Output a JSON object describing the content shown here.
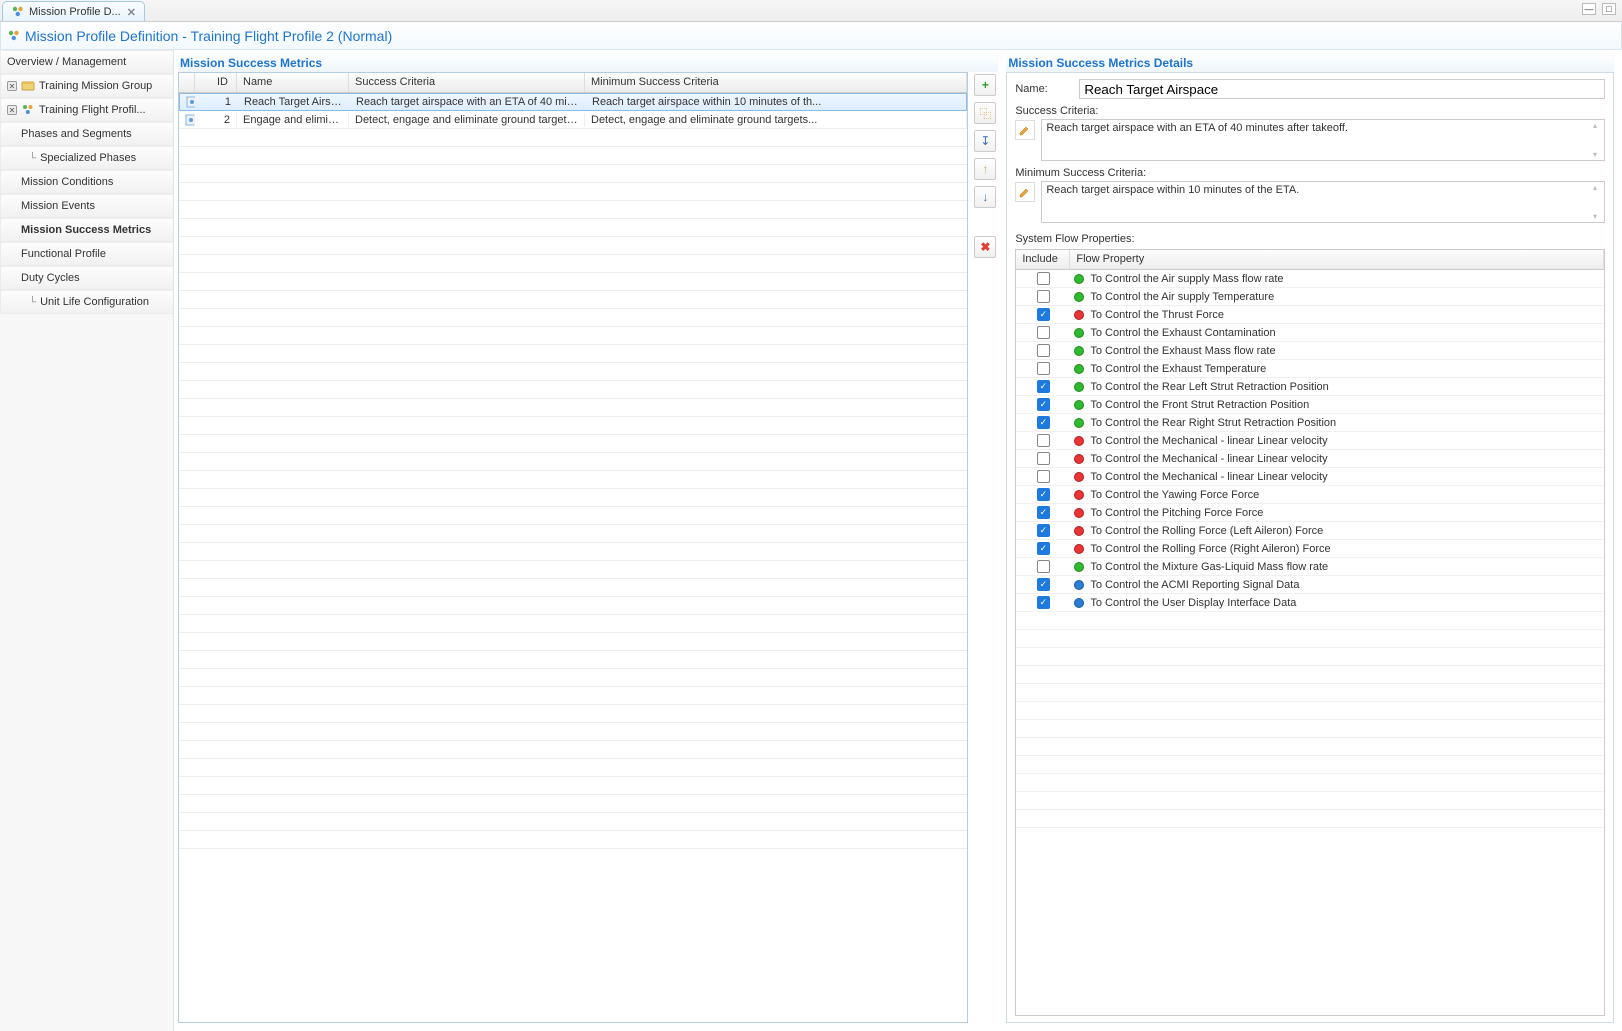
{
  "tab": {
    "label": "Mission Profile D..."
  },
  "title": "Mission Profile Definition - Training Flight Profile 2 (Normal)",
  "sidebar": [
    {
      "label": "Overview / Management",
      "indent": 0,
      "bold": false,
      "has_expand": false,
      "icon": "none"
    },
    {
      "label": "Training Mission Group",
      "indent": 0,
      "bold": false,
      "has_expand": true,
      "icon": "group"
    },
    {
      "label": "Training Flight Profil...",
      "indent": 0,
      "bold": false,
      "has_expand": true,
      "icon": "profile"
    },
    {
      "label": "Phases and Segments",
      "indent": 1,
      "bold": false,
      "has_expand": false,
      "icon": "none"
    },
    {
      "label": "Specialized Phases",
      "indent": 2,
      "bold": false,
      "has_expand": false,
      "icon": "none",
      "prefix": "└"
    },
    {
      "label": "Mission Conditions",
      "indent": 1,
      "bold": false,
      "has_expand": false,
      "icon": "none"
    },
    {
      "label": "Mission Events",
      "indent": 1,
      "bold": false,
      "has_expand": false,
      "icon": "none"
    },
    {
      "label": "Mission Success Metrics",
      "indent": 1,
      "bold": true,
      "has_expand": false,
      "icon": "none"
    },
    {
      "label": "Functional Profile",
      "indent": 1,
      "bold": false,
      "has_expand": false,
      "icon": "none"
    },
    {
      "label": "Duty Cycles",
      "indent": 1,
      "bold": false,
      "has_expand": false,
      "icon": "none"
    },
    {
      "label": "Unit Life Configuration",
      "indent": 2,
      "bold": false,
      "has_expand": false,
      "icon": "none",
      "prefix": "└"
    }
  ],
  "metrics": {
    "title": "Mission Success Metrics",
    "columns": {
      "id": "ID",
      "name": "Name",
      "sc": "Success Criteria",
      "mc": "Minimum Success Criteria"
    },
    "rows": [
      {
        "id": "1",
        "name": "Reach Target Airspa...",
        "sc": "Reach target airspace with an ETA of 40 min...",
        "mc": "Reach target airspace within 10 minutes of th...",
        "selected": true
      },
      {
        "id": "2",
        "name": "Engage and eliminat...",
        "sc": "Detect, engage and eliminate ground targets...",
        "mc": "Detect, engage and eliminate ground targets...",
        "selected": false
      }
    ]
  },
  "toolbar": {
    "add": "+",
    "copy": "⿻",
    "import": "↧",
    "up": "↑",
    "down": "↓",
    "delete": "✖"
  },
  "details": {
    "title": "Mission Success Metrics Details",
    "name_label": "Name:",
    "name_value": "Reach Target Airspace",
    "sc_label": "Success Criteria:",
    "sc_value": "Reach target airspace with an ETA of 40 minutes after takeoff.",
    "mc_label": "Minimum Success Criteria:",
    "mc_value": "Reach target airspace within 10 minutes of the ETA.",
    "flow_label": "System Flow Properties:",
    "flow_columns": {
      "include": "Include",
      "prop": "Flow Property"
    },
    "flows": [
      {
        "inc": false,
        "color": "green",
        "text": "To Control the Air supply Mass flow rate"
      },
      {
        "inc": false,
        "color": "green",
        "text": "To Control the Air supply Temperature"
      },
      {
        "inc": true,
        "color": "red",
        "text": "To Control the Thrust Force"
      },
      {
        "inc": false,
        "color": "green",
        "text": "To Control the Exhaust Contamination"
      },
      {
        "inc": false,
        "color": "green",
        "text": "To Control the Exhaust Mass flow rate"
      },
      {
        "inc": false,
        "color": "green",
        "text": "To Control the Exhaust Temperature"
      },
      {
        "inc": true,
        "color": "green",
        "text": "To Control the Rear Left Strut Retraction Position"
      },
      {
        "inc": true,
        "color": "green",
        "text": "To Control the Front Strut Retraction Position"
      },
      {
        "inc": true,
        "color": "green",
        "text": "To Control the Rear Right Strut Retraction Position"
      },
      {
        "inc": false,
        "color": "red",
        "text": "To Control the Mechanical - linear Linear velocity"
      },
      {
        "inc": false,
        "color": "red",
        "text": "To Control the Mechanical - linear Linear velocity"
      },
      {
        "inc": false,
        "color": "red",
        "text": "To Control the Mechanical - linear Linear velocity"
      },
      {
        "inc": true,
        "color": "red",
        "text": "To Control the Yawing Force Force"
      },
      {
        "inc": true,
        "color": "red",
        "text": "To Control the Pitching Force Force"
      },
      {
        "inc": true,
        "color": "red",
        "text": "To Control the Rolling Force (Left Aileron) Force"
      },
      {
        "inc": true,
        "color": "red",
        "text": "To Control the Rolling Force (Right Aileron) Force"
      },
      {
        "inc": false,
        "color": "green",
        "text": "To Control the Mixture Gas-Liquid Mass flow rate"
      },
      {
        "inc": true,
        "color": "blue",
        "text": "To Control the ACMI Reporting Signal Data"
      },
      {
        "inc": true,
        "color": "blue",
        "text": "To Control the User Display Interface Data"
      }
    ]
  }
}
